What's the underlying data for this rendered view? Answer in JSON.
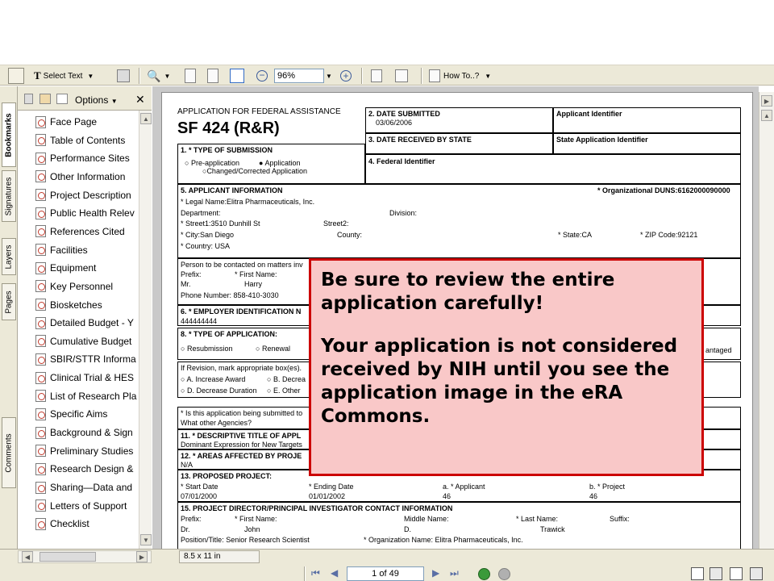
{
  "toolbar": {
    "select_text_label": "Select Text",
    "zoom_value": "96%",
    "how_to_label": "How To..?"
  },
  "navigation": {
    "options_label": "Options",
    "tabs": [
      "Bookmarks",
      "Signatures",
      "Layers",
      "Pages",
      "Comments"
    ],
    "bookmarks": [
      "Face Page",
      "Table of Contents",
      "Performance Sites",
      "Other Information",
      "Project Description",
      "Public Health Relev",
      "References Cited",
      "Facilities",
      "Equipment",
      "Key Personnel",
      "Biosketches",
      "Detailed Budget - Y",
      "Cumulative Budget",
      "SBIR/STTR Informa",
      "Clinical Trial & HES",
      "List of Research Pla",
      "Specific Aims",
      "Background & Sign",
      "Preliminary Studies",
      "Research Design &",
      "Sharing—Data and",
      "Letters of Support",
      "Checklist"
    ]
  },
  "form": {
    "header_small": "APPLICATION FOR FEDERAL ASSISTANCE",
    "header_big": "SF 424 (R&R)",
    "date_submitted_label": "2. DATE SUBMITTED",
    "date_submitted_value": "03/06/2006",
    "applicant_identifier": "Applicant Identifier",
    "date_received_label": "3. DATE RECEIVED BY STATE",
    "state_app_identifier": "State Application Identifier",
    "type_submission": "1. * TYPE OF SUBMISSION",
    "pre_application": "Pre-application",
    "application": "Application",
    "changed_corrected": "Changed/Corrected Application",
    "federal_identifier": "4. Federal Identifier",
    "applicant_info": "5. APPLICANT INFORMATION",
    "duns": "* Organizational DUNS:6162000090000",
    "legal_name": "* Legal Name:Elitra Pharmaceuticals, Inc.",
    "department": "Department:",
    "division": "Division:",
    "street1": "* Street1:3510 Dunhill St",
    "street2": "Street2:",
    "city": "* City:San Diego",
    "county": "County:",
    "state": "* State:CA",
    "zip": "* ZIP Code:92121",
    "country": "* Country: USA",
    "contact": "Person to be contacted on matters inv",
    "prefix": "Prefix:",
    "first_name": "* First Name:",
    "mr": "Mr.",
    "harry": "Harry",
    "phone": "Phone Number: 858-410-3030",
    "ein": "6. * EMPLOYER IDENTIFICATION N",
    "ein_value": "444444444",
    "type_app": "8. * TYPE OF APPLICATION:",
    "resubmission": "Resubmission",
    "renewal": "Renewal",
    "disadvantaged": "antaged",
    "revision": "If Revision, mark appropriate box(es).",
    "increase_award": "A. Increase Award",
    "decrease": "B. Decrea",
    "decrease_duration": "D. Decrease Duration",
    "other": "E. Other",
    "other_agencies_q": "* Is this application being submitted to",
    "other_agencies": "What other Agencies?",
    "title_label": "11. * DESCRIPTIVE TITLE OF APPL",
    "title_value": "Dominant Expression for New Targets",
    "areas_label": "12. * AREAS AFFECTED BY PROJE",
    "areas_value": "N/A",
    "proposed_label": "13. PROPOSED PROJECT:",
    "start_date": "* Start Date",
    "start_value": "07/01/2000",
    "end_date": "* Ending Date",
    "end_value": "01/01/2002",
    "applicant_cd": "a. * Applicant",
    "applicant_cd_value": "46",
    "project_cd": "b. * Project",
    "project_cd_value": "46",
    "pd_label": "15. PROJECT DIRECTOR/PRINCIPAL INVESTIGATOR CONTACT INFORMATION",
    "pd_prefix": "Prefix:",
    "pd_first": "* First Name:",
    "pd_middle": "Middle Name:",
    "pd_last": "* Last Name:",
    "pd_suffix": "Suffix:",
    "pd_dr": "Dr.",
    "pd_john": "John",
    "pd_d": "D.",
    "pd_trawick": "Trawick",
    "pd_position": "Position/Title: Senior Research Scientist",
    "pd_org": "* Organization Name: Elitra Pharmaceuticals, Inc."
  },
  "status_bar": {
    "page_size": "8.5 x 11 in",
    "page_indicator": "1 of 49"
  },
  "callout": {
    "line1": "Be sure to review the entire application carefully!",
    "line2": "Your application is not considered received by NIH until you see the application image in the eRA Commons."
  }
}
